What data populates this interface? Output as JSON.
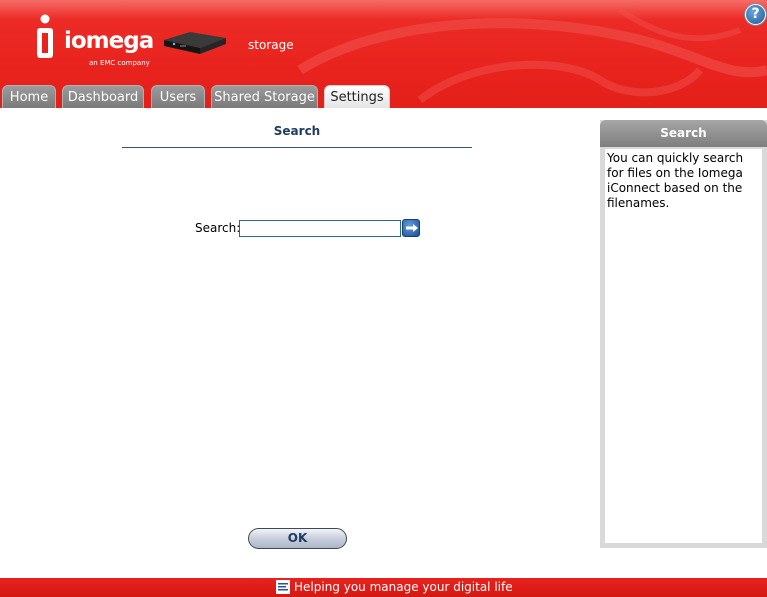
{
  "brand": {
    "name": "iomega",
    "tagline": "an EMC company",
    "product": "storage"
  },
  "help": {
    "label": "?"
  },
  "tabs": [
    {
      "label": "Home",
      "active": false
    },
    {
      "label": "Dashboard",
      "active": false
    },
    {
      "label": "Users",
      "active": false
    },
    {
      "label": "Shared Storage",
      "active": false
    },
    {
      "label": "Settings",
      "active": true
    }
  ],
  "main": {
    "title": "Search",
    "search_label": "Search:",
    "search_value": "",
    "go_icon": "arrow-right-icon",
    "ok_label": "OK"
  },
  "side_panel": {
    "title": "Search",
    "body": "You can quickly search for files on the Iomega iConnect based on the filenames."
  },
  "footer": {
    "icon": "menu-lines-icon",
    "text": "Helping you manage your digital life"
  },
  "colors": {
    "header_red": "#e8221d",
    "tab_gray": "#8a8a8a",
    "accent_blue": "#1f3b63"
  }
}
